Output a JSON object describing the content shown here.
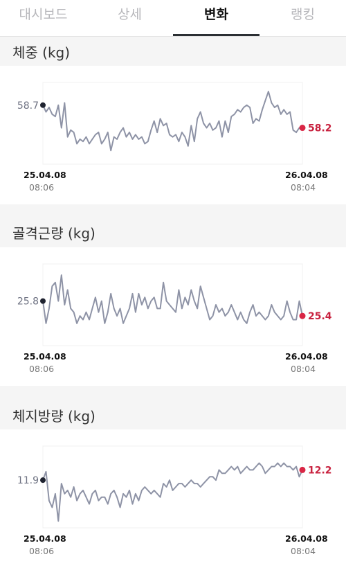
{
  "tabs": [
    "대시보드",
    "상세",
    "변화",
    "랭킹"
  ],
  "active_tab": 2,
  "start": {
    "date": "25.04.08",
    "time": "08:06"
  },
  "end": {
    "date": "26.04.08",
    "time": "08:04"
  },
  "colors": {
    "line": "#8e93a6",
    "start_dot": "#1f2330",
    "end_dot": "#d92645",
    "end_text": "#c8223f",
    "start_text": "#6e7282"
  },
  "chart_data": [
    {
      "type": "line",
      "title": "체중 (kg)",
      "start_value": "58.7",
      "end_value": "58.2",
      "x_range": [
        "25.04.08 08:06",
        "26.04.08 08:04"
      ],
      "ylim": [
        57.4,
        59.2
      ],
      "values": [
        58.7,
        58.55,
        58.65,
        58.5,
        58.45,
        58.7,
        58.2,
        58.75,
        58.0,
        58.15,
        58.1,
        57.85,
        57.95,
        57.9,
        58.0,
        57.85,
        57.95,
        58.05,
        58.1,
        57.85,
        57.95,
        58.1,
        57.7,
        58.0,
        57.95,
        58.1,
        58.2,
        58.0,
        58.1,
        57.95,
        58.05,
        57.95,
        58.0,
        57.85,
        57.9,
        58.15,
        58.35,
        58.1,
        58.4,
        58.25,
        58.3,
        58.05,
        58.0,
        58.05,
        57.9,
        58.1,
        58.0,
        57.8,
        58.25,
        57.9,
        58.4,
        58.55,
        58.3,
        58.2,
        58.3,
        58.15,
        58.2,
        58.35,
        58.0,
        58.35,
        58.1,
        58.45,
        58.5,
        58.6,
        58.55,
        58.65,
        58.7,
        58.65,
        58.3,
        58.4,
        58.35,
        58.6,
        58.8,
        59.0,
        58.75,
        58.65,
        58.7,
        58.5,
        58.6,
        58.5,
        58.55,
        58.15,
        58.1,
        58.2,
        58.2
      ]
    },
    {
      "type": "line",
      "title": "골격근량 (kg)",
      "start_value": "25.8",
      "end_value": "25.4",
      "x_range": [
        "25.04.08 08:06",
        "26.04.08 08:04"
      ],
      "ylim": [
        24.6,
        26.8
      ],
      "values": [
        25.8,
        25.2,
        25.6,
        26.2,
        26.3,
        25.8,
        26.5,
        25.7,
        26.1,
        25.6,
        25.5,
        25.2,
        25.4,
        25.3,
        25.5,
        25.3,
        25.6,
        25.9,
        25.5,
        25.8,
        25.2,
        25.5,
        26.0,
        25.6,
        25.4,
        25.6,
        25.2,
        25.4,
        25.6,
        26.0,
        25.5,
        26.0,
        25.7,
        25.9,
        25.6,
        25.8,
        25.9,
        25.6,
        25.6,
        26.3,
        25.8,
        25.7,
        25.6,
        25.5,
        26.1,
        25.6,
        25.9,
        25.7,
        26.1,
        25.8,
        25.6,
        26.2,
        25.9,
        25.6,
        25.3,
        25.4,
        25.7,
        25.5,
        25.6,
        25.4,
        25.5,
        25.7,
        25.5,
        25.3,
        25.5,
        25.3,
        25.2,
        25.5,
        25.7,
        25.4,
        25.5,
        25.4,
        25.3,
        25.4,
        25.7,
        25.5,
        25.4,
        25.3,
        25.4,
        25.8,
        25.5,
        25.3,
        25.3,
        25.8,
        25.4
      ]
    },
    {
      "type": "line",
      "title": "체지방량 (kg)",
      "start_value": "11.9",
      "end_value": "12.2",
      "x_range": [
        "25.04.08 08:06",
        "26.04.08 08:04"
      ],
      "ylim": [
        10.5,
        12.9
      ],
      "values": [
        11.9,
        12.15,
        11.3,
        11.1,
        11.5,
        10.7,
        11.8,
        11.5,
        11.6,
        11.4,
        11.7,
        11.3,
        11.5,
        11.6,
        11.4,
        11.2,
        11.5,
        11.6,
        11.3,
        11.4,
        11.4,
        11.2,
        11.5,
        11.6,
        11.4,
        11.1,
        11.5,
        11.4,
        11.6,
        11.2,
        11.5,
        11.3,
        11.6,
        11.7,
        11.6,
        11.5,
        11.6,
        11.5,
        11.4,
        11.8,
        11.7,
        11.9,
        11.6,
        11.7,
        11.8,
        11.8,
        11.7,
        11.8,
        11.9,
        11.8,
        11.8,
        11.7,
        11.8,
        11.9,
        12.0,
        12.0,
        11.9,
        12.2,
        12.1,
        12.1,
        12.2,
        12.3,
        12.2,
        12.3,
        12.1,
        12.2,
        12.3,
        12.2,
        12.2,
        12.3,
        12.4,
        12.3,
        12.1,
        12.2,
        12.3,
        12.3,
        12.4,
        12.3,
        12.4,
        12.3,
        12.3,
        12.2,
        12.3,
        12.0,
        12.2
      ]
    }
  ]
}
